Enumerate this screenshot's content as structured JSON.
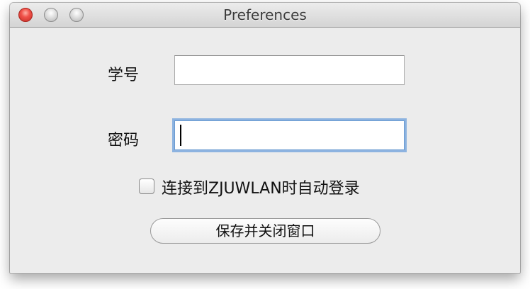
{
  "window": {
    "title": "Preferences",
    "controls": {
      "close": "close-button",
      "minimize": "minimize-button",
      "zoom": "zoom-button"
    }
  },
  "form": {
    "student_id_label": "学号",
    "student_id_value": "",
    "password_label": "密码",
    "password_value": "",
    "auto_login_label": "连接到ZJUWLAN时自动登录",
    "auto_login_checked": false,
    "save_button_label": "保存并关闭窗口"
  }
}
